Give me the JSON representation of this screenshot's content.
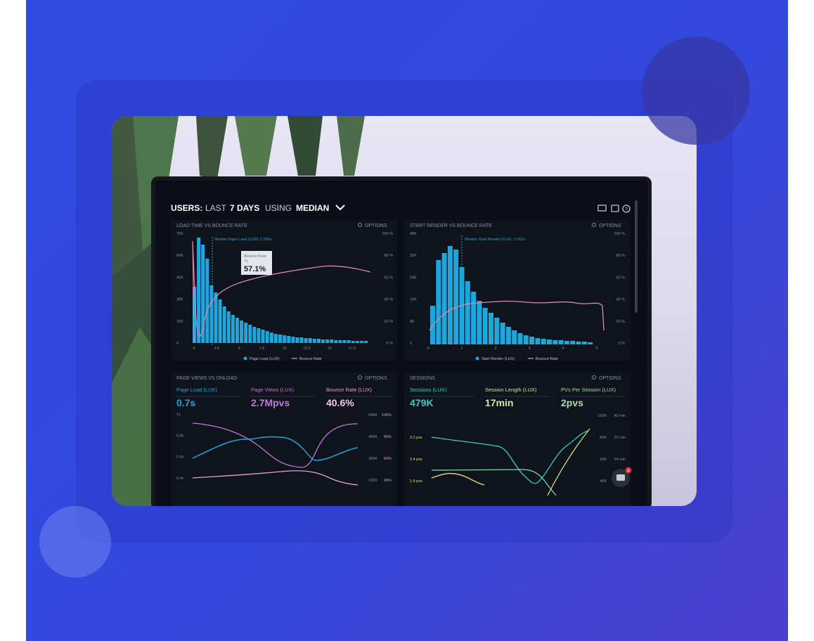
{
  "dashboard": {
    "title_users": "USERS:",
    "title_last": "LAST",
    "title_days": "7 DAYS",
    "title_using": "USING",
    "title_median": "MEDIAN",
    "options": "OPTIONS",
    "panel1": {
      "title": "LOAD TIME VS BOUNCE RATE",
      "median_label": "Median Page Load (LUX): 2.056s",
      "tooltip_label": "Bounce Rate",
      "tooltip_sub": "7s",
      "tooltip_value": "57.1%",
      "y_left": [
        "75K",
        "60K",
        "45K",
        "30K",
        "15K",
        "0"
      ],
      "y_right": [
        "100 %",
        "80 %",
        "60 %",
        "40 %",
        "20 %",
        "0 %"
      ],
      "x_ticks": [
        "0",
        "2.5",
        "5",
        "7.5",
        "10",
        "12.5",
        "15",
        "17.5"
      ],
      "legend": [
        "Page Load (LUX)",
        "Bounce Rate"
      ]
    },
    "panel2": {
      "title": "START RENDER VS BOUNCE RATE",
      "median_label": "Median Start Render (LUX): 1.051s",
      "y_left": [
        "40K",
        "32K",
        "24K",
        "16K",
        "8K",
        "0"
      ],
      "y_right": [
        "100 %",
        "80 %",
        "60 %",
        "40 %",
        "20 %",
        "0 %"
      ],
      "x_ticks": [
        "0",
        "1",
        "2",
        "3",
        "4",
        "5"
      ],
      "legend": [
        "Start Render (LUX)",
        "Bounce Rate"
      ]
    },
    "panel3": {
      "title": "PAGE VIEWS VS ONLOAD",
      "metrics": [
        {
          "label": "Page Load (LUX)",
          "value": "0.7s"
        },
        {
          "label": "Page Views (LUX)",
          "value": "2.7Mpvs"
        },
        {
          "label": "Bounce Rate (LUX)",
          "value": "40.6%"
        }
      ],
      "y_left": [
        "1s",
        "0.8s",
        "0.6s",
        "0.4s"
      ],
      "y_mid": [
        "500K",
        "400K",
        "300K",
        "200K"
      ],
      "y_right": [
        "100%",
        "80%",
        "60%",
        "40%"
      ]
    },
    "panel4": {
      "title": "SESSIONS",
      "metrics": [
        {
          "label": "Sessions (LUX)",
          "value": "479K"
        },
        {
          "label": "Session Length (LUX)",
          "value": "17min"
        },
        {
          "label": "PVs Per Session (LUX)",
          "value": "2pvs"
        }
      ],
      "y_left": [
        "3.2 pvs",
        "2.4 pvs",
        "1.6 pvs"
      ],
      "y_mid": [
        "100K",
        "80K",
        "60K",
        "40K"
      ],
      "y_right": [
        "40 min",
        "32 min",
        "24 min"
      ]
    },
    "chat_badge": "4"
  },
  "colors": {
    "background": "#3348dc",
    "screen": "#0b0e16",
    "bar": "#1da7dc",
    "pink": "#d98ab0",
    "teal": "#2fd0c8",
    "purple": "#c07ad8",
    "green": "#9be0a6"
  }
}
